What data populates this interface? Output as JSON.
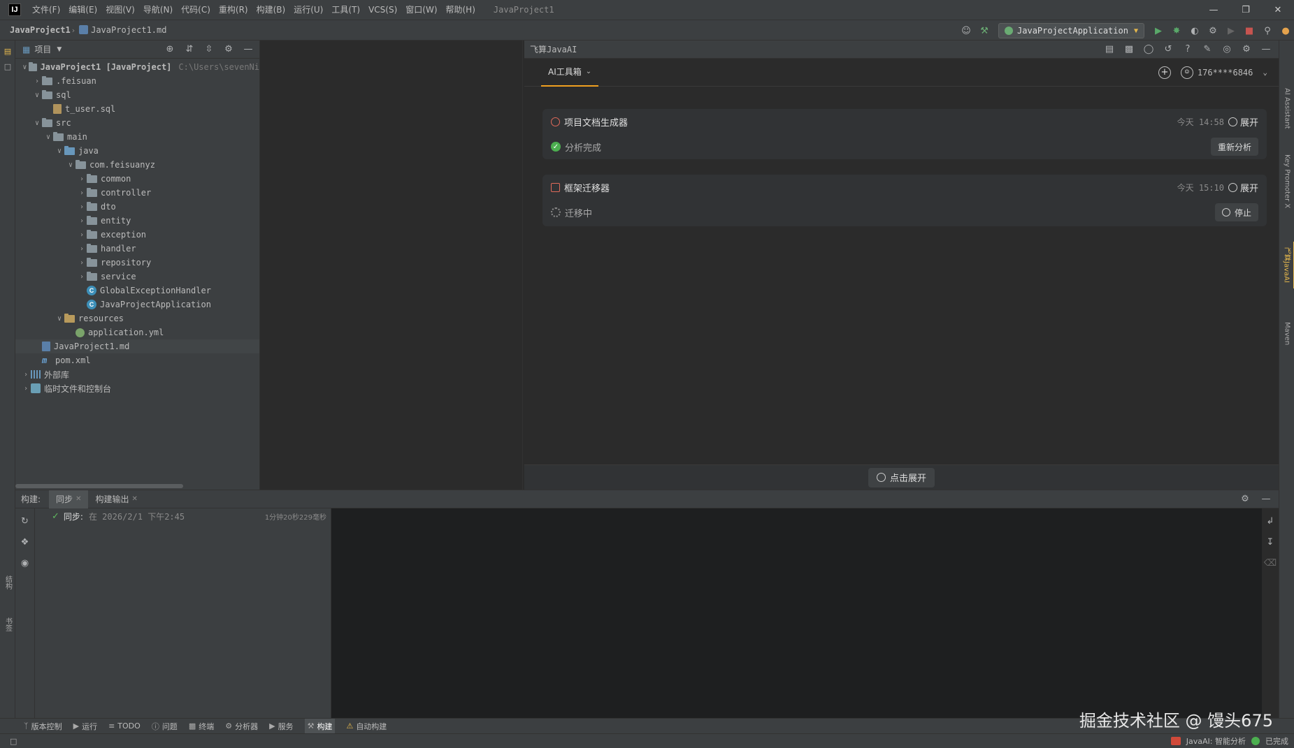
{
  "menubar": {
    "items": [
      "文件(F)",
      "编辑(E)",
      "视图(V)",
      "导航(N)",
      "代码(C)",
      "重构(R)",
      "构建(B)",
      "运行(U)",
      "工具(T)",
      "VCS(S)",
      "窗口(W)",
      "帮助(H)"
    ],
    "window_title": "JavaProject1"
  },
  "navbar": {
    "breadcrumb_project": "JavaProject1",
    "breadcrumb_file": "JavaProject1.md",
    "run_config": "JavaProjectApplication"
  },
  "project_panel": {
    "title": "项目",
    "tree": [
      {
        "label": "JavaProject1 [JavaProject]",
        "path": "C:\\Users\\sevenNi",
        "depth": 0,
        "type": "folder",
        "expanded": true
      },
      {
        "label": ".feisuan",
        "depth": 1,
        "type": "folder",
        "expanded": false
      },
      {
        "label": "sql",
        "depth": 1,
        "type": "folder",
        "expanded": true
      },
      {
        "label": "t_user.sql",
        "depth": 2,
        "type": "sql"
      },
      {
        "label": "src",
        "depth": 1,
        "type": "folder",
        "expanded": true
      },
      {
        "label": "main",
        "depth": 2,
        "type": "folder",
        "expanded": true
      },
      {
        "label": "java",
        "depth": 3,
        "type": "src",
        "expanded": true
      },
      {
        "label": "com.feisuanyz",
        "depth": 4,
        "type": "folder",
        "expanded": true
      },
      {
        "label": "common",
        "depth": 5,
        "type": "folder",
        "expanded": false
      },
      {
        "label": "controller",
        "depth": 5,
        "type": "folder",
        "expanded": false
      },
      {
        "label": "dto",
        "depth": 5,
        "type": "folder",
        "expanded": false
      },
      {
        "label": "entity",
        "depth": 5,
        "type": "folder",
        "expanded": false
      },
      {
        "label": "exception",
        "depth": 5,
        "type": "folder",
        "expanded": false
      },
      {
        "label": "handler",
        "depth": 5,
        "type": "folder",
        "expanded": false
      },
      {
        "label": "repository",
        "depth": 5,
        "type": "folder",
        "expanded": false
      },
      {
        "label": "service",
        "depth": 5,
        "type": "folder",
        "expanded": false
      },
      {
        "label": "GlobalExceptionHandler",
        "depth": 5,
        "type": "class"
      },
      {
        "label": "JavaProjectApplication",
        "depth": 5,
        "type": "class"
      },
      {
        "label": "resources",
        "depth": 3,
        "type": "res",
        "expanded": true
      },
      {
        "label": "application.yml",
        "depth": 4,
        "type": "yml"
      },
      {
        "label": "JavaProject1.md",
        "depth": 1,
        "type": "md",
        "selected": true
      },
      {
        "label": "pom.xml",
        "depth": 1,
        "type": "xml"
      },
      {
        "label": "外部库",
        "depth": 0,
        "type": "lib",
        "expanded": false
      },
      {
        "label": "临时文件和控制台",
        "depth": 0,
        "type": "scratch",
        "expanded": false
      }
    ]
  },
  "ai_panel": {
    "title": "飞算JavaAI",
    "tab_label": "AI工具箱",
    "user": "176****6846",
    "cards": [
      {
        "title": "项目文档生成器",
        "time": "今天 14:58",
        "expand": "展开",
        "status": "分析完成",
        "action": "重新分析"
      },
      {
        "title": "框架迁移器",
        "time": "今天 15:10",
        "expand": "展开",
        "status": "迁移中",
        "action": "停止"
      }
    ],
    "footer_button": "点击展开"
  },
  "build_panel": {
    "label": "构建:",
    "tabs": [
      "同步",
      "构建输出"
    ],
    "sync_label": "同步:",
    "sync_detail": "在 2026/2/1 下午2:45",
    "sync_duration": "1分钟20秒229毫秒"
  },
  "tool_strip": {
    "items": [
      "版本控制",
      "运行",
      "TODO",
      "问题",
      "终端",
      "分析器",
      "服务",
      "构建",
      "自动构建"
    ]
  },
  "status_bar": {
    "ai_status": "JavaAI: 智能分析",
    "done": "已完成"
  },
  "right_stripe": [
    "AI Assistant",
    "Key Promoter X",
    "飞算JavaAI",
    "Maven"
  ],
  "left_stripe_bottom": [
    "结构",
    "书签"
  ],
  "watermark": "掘金技术社区 @ 馒头675"
}
